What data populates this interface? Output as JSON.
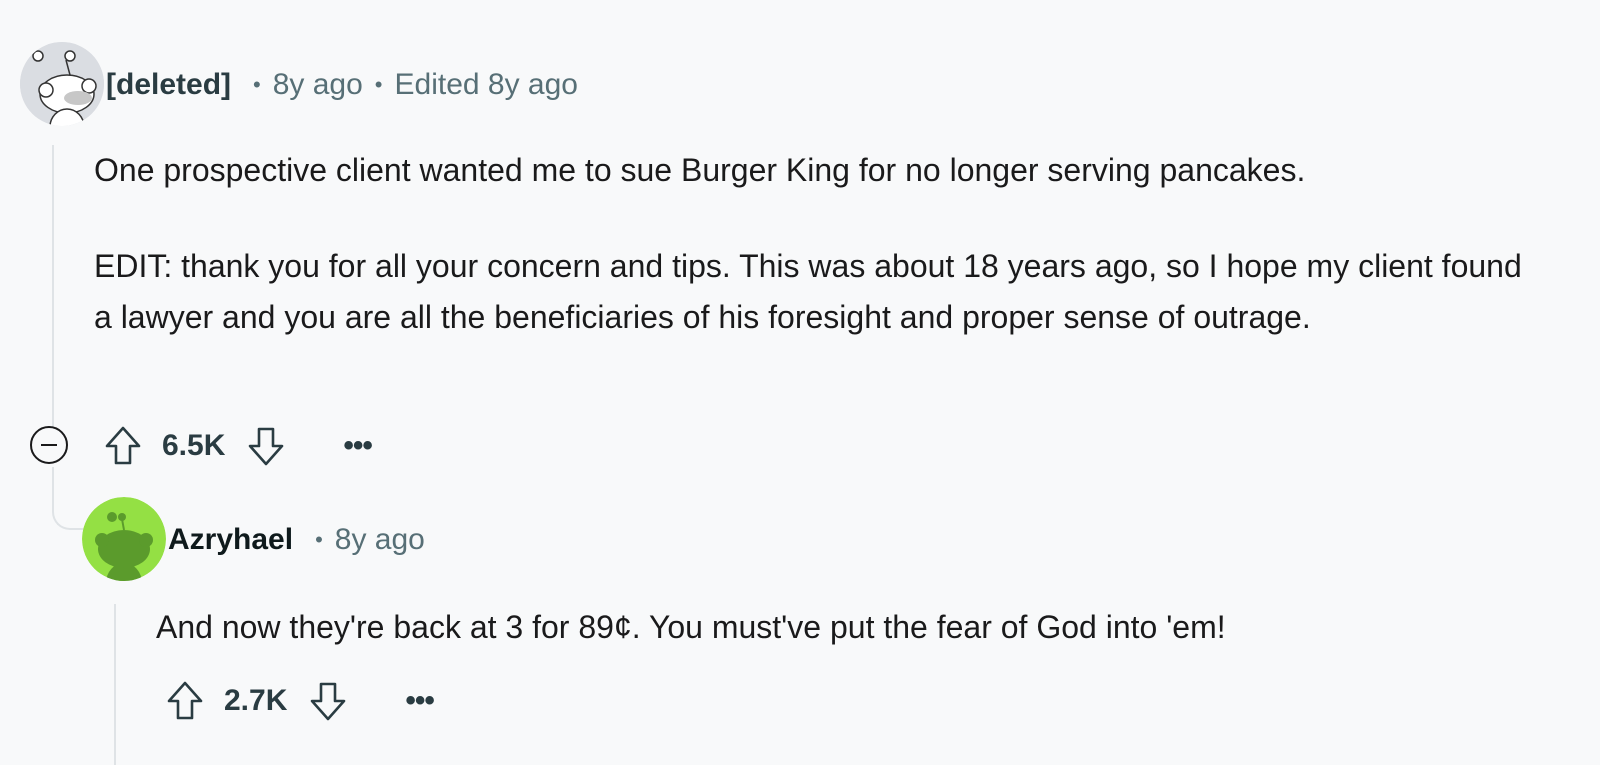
{
  "comment": {
    "author": "[deleted]",
    "time": "8y ago",
    "edited": "Edited 8y ago",
    "paragraphs": [
      "One prospective client wanted me to sue Burger King for no longer serving pancakes.",
      "EDIT: thank you for all your concern and tips. This was about 18 years ago, so I hope my client found a lawyer and you are all the beneficiaries of his foresight and proper sense of outrage."
    ],
    "score": "6.5K",
    "more": "•••",
    "avatar_color": "#ffffff"
  },
  "reply": {
    "author": "Azryhael",
    "time": "8y ago",
    "text": "And now they're back at 3 for 89¢. You must've put the fear of God into 'em!",
    "score": "2.7K",
    "more": "•••",
    "avatar_color": "#94e044"
  },
  "separator": "•"
}
